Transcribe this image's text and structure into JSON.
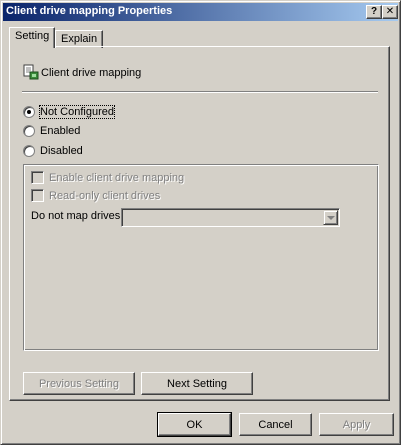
{
  "window": {
    "title": "Client drive mapping Properties",
    "help_glyph": "?",
    "close_glyph": "✕"
  },
  "tabs": [
    {
      "label": "Setting",
      "active": true
    },
    {
      "label": "Explain",
      "active": false
    }
  ],
  "policy": {
    "icon": "policy-setting-icon",
    "title": "Client drive mapping"
  },
  "radios": [
    {
      "label": "Not Configured",
      "checked": true
    },
    {
      "label": "Enabled",
      "checked": false
    },
    {
      "label": "Disabled",
      "checked": false
    }
  ],
  "options": {
    "checkboxes": [
      {
        "label": "Enable client drive mapping",
        "checked": false,
        "enabled": false
      },
      {
        "label": "Read-only client drives",
        "checked": false,
        "enabled": false
      }
    ],
    "dropdown_label": "Do not map drives",
    "dropdown_value": ""
  },
  "nav_buttons": {
    "previous": "Previous Setting",
    "next": "Next Setting"
  },
  "dialog_buttons": {
    "ok": "OK",
    "cancel": "Cancel",
    "apply": "Apply"
  },
  "colors": {
    "face": "#d4d0c8",
    "title_start": "#0a246a",
    "title_end": "#a6caf0",
    "disabled_text": "#808080"
  }
}
